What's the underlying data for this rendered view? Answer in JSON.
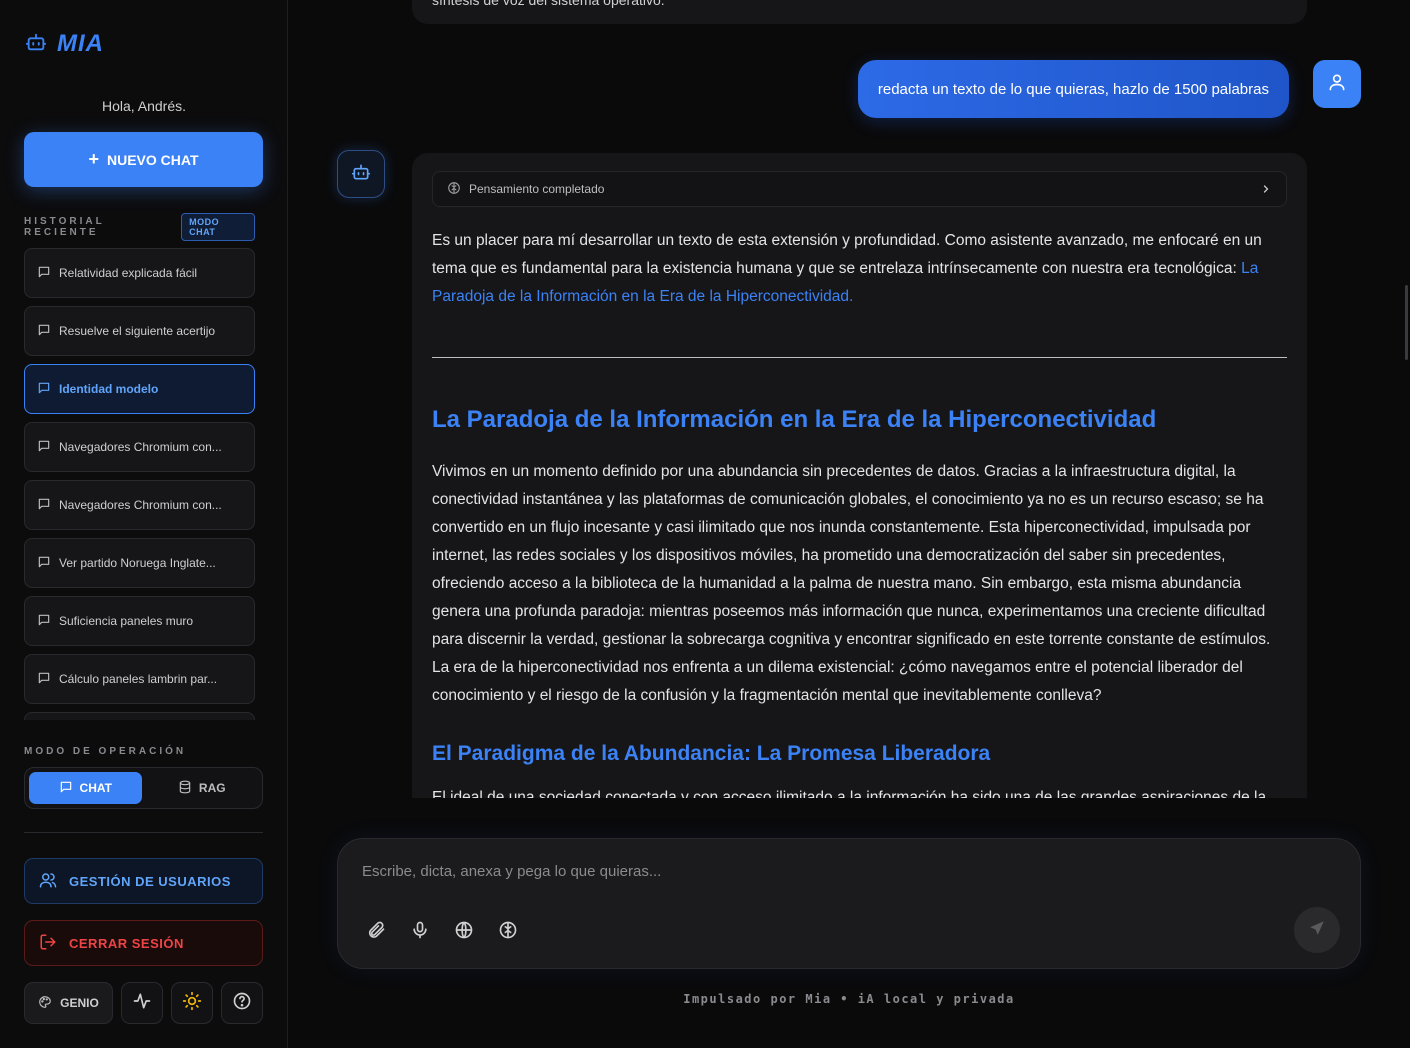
{
  "app": {
    "name": "MIA",
    "greeting": "Hola, Andrés."
  },
  "sidebar": {
    "new_chat_label": "NUEVO CHAT",
    "history_title": "HISTORIAL RECIENTE",
    "mode_badge": "MODO CHAT",
    "history": [
      {
        "label": "Relatividad explicada fácil",
        "active": false
      },
      {
        "label": "Resuelve el siguiente acertijo",
        "active": false
      },
      {
        "label": "Identidad modelo",
        "active": true
      },
      {
        "label": "Navegadores Chromium con...",
        "active": false
      },
      {
        "label": "Navegadores Chromium con...",
        "active": false
      },
      {
        "label": "Ver partido Noruega Inglate...",
        "active": false
      },
      {
        "label": "Suficiencia paneles muro",
        "active": false
      },
      {
        "label": "Cálculo paneles lambrin par...",
        "active": false
      },
      {
        "label": "",
        "active": false
      }
    ],
    "op_mode_title": "MODO DE OPERACIÓN",
    "op_modes": {
      "chat": "CHAT",
      "rag": "RAG",
      "selected": "chat"
    },
    "users_label": "GESTIÓN DE USUARIOS",
    "logout_label": "CERRAR SESIÓN",
    "theme_label": "GENIO"
  },
  "chat": {
    "prev_text": "síntesis de voz del sistema operativo.",
    "user_message": "redacta un texto de lo que quieras, hazlo de 1500 palabras",
    "thinking_label": "Pensamiento completado",
    "intro": "Es un placer para mí desarrollar un texto de esta extensión y profundidad. Como asistente avanzado, me enfocaré en un tema que es fundamental para la existencia humana y que se entrelaza intrínsecamente con nuestra era tecnológica: ",
    "intro_link": "La Paradoja de la Información en la Era de la Hiperconectividad.",
    "heading1": "La Paradoja de la Información en la Era de la Hiperconectividad",
    "paragraph1": "Vivimos en un momento definido por una abundancia sin precedentes de datos. Gracias a la infraestructura digital, la conectividad instantánea y las plataformas de comunicación globales, el conocimiento ya no es un recurso escaso; se ha convertido en un flujo incesante y casi ilimitado que nos inunda constantemente. Esta hiperconectividad, impulsada por internet, las redes sociales y los dispositivos móviles, ha prometido una democratización del saber sin precedentes, ofreciendo acceso a la biblioteca de la humanidad a la palma de nuestra mano. Sin embargo, esta misma abundancia genera una profunda paradoja: mientras poseemos más información que nunca, experimentamos una creciente dificultad para discernir la verdad, gestionar la sobrecarga cognitiva y encontrar significado en este torrente constante de estímulos. La era de la hiperconectividad nos enfrenta a un dilema existencial: ¿cómo navegamos entre el potencial liberador del conocimiento y el riesgo de la confusión y la fragmentación mental que inevitablemente conlleva?",
    "heading2": "El Paradigma de la Abundancia: La Promesa Liberadora",
    "paragraph2": "El ideal de una sociedad conectada y con acceso ilimitado a la información ha sido una de las grandes aspiraciones de la modernidad."
  },
  "composer": {
    "placeholder": "Escribe, dicta, anexa y pega lo que quieras..."
  },
  "footer": "Impulsado por Mia • iA local y privada",
  "colors": {
    "accent": "#3b82f6",
    "danger": "#ef4444",
    "background": "#0a0a0b"
  }
}
